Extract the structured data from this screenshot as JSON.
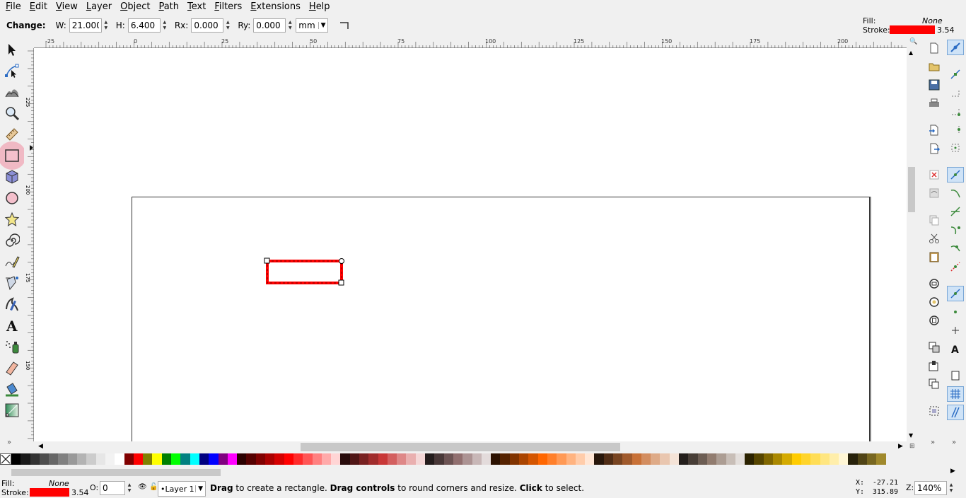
{
  "menu": [
    "File",
    "Edit",
    "View",
    "Layer",
    "Object",
    "Path",
    "Text",
    "Filters",
    "Extensions",
    "Help"
  ],
  "controls": {
    "change_label": "Change:",
    "w_label": "W:",
    "w_value": "21.000",
    "h_label": "H:",
    "h_value": "6.400",
    "rx_label": "Rx:",
    "rx_value": "0.000",
    "ry_label": "Ry:",
    "ry_value": "0.000",
    "unit": "mm"
  },
  "style_indicator_top": {
    "fill_label": "Fill:",
    "fill_value": "None",
    "stroke_label": "Stroke:",
    "stroke_width": "3.54",
    "stroke_color": "#ff0000"
  },
  "tools": [
    {
      "name": "selector-tool-icon",
      "icon": "arrow"
    },
    {
      "name": "node-tool-icon",
      "icon": "node"
    },
    {
      "name": "tweak-tool-icon",
      "icon": "tweak"
    },
    {
      "name": "zoom-tool-icon",
      "icon": "zoom"
    },
    {
      "name": "measure-tool-icon",
      "icon": "ruler"
    },
    {
      "name": "rect-tool-icon",
      "icon": "rect",
      "active": true
    },
    {
      "name": "3dbox-tool-icon",
      "icon": "box"
    },
    {
      "name": "ellipse-tool-icon",
      "icon": "ellipse"
    },
    {
      "name": "star-tool-icon",
      "icon": "star"
    },
    {
      "name": "spiral-tool-icon",
      "icon": "spiral"
    },
    {
      "name": "pencil-tool-icon",
      "icon": "pencil"
    },
    {
      "name": "pen-tool-icon",
      "icon": "pen"
    },
    {
      "name": "calligraphy-tool-icon",
      "icon": "calligraphy"
    },
    {
      "name": "text-tool-icon",
      "icon": "text"
    },
    {
      "name": "spray-tool-icon",
      "icon": "spray"
    },
    {
      "name": "eraser-tool-icon",
      "icon": "eraser"
    },
    {
      "name": "paint-bucket-tool-icon",
      "icon": "bucket"
    },
    {
      "name": "gradient-tool-icon",
      "icon": "gradient"
    }
  ],
  "ruler_top_labels": [
    "-25",
    "0",
    "25",
    "50",
    "75",
    "100",
    "125",
    "150",
    "175",
    "200"
  ],
  "ruler_left_labels": [
    "225",
    "200",
    "175",
    "150"
  ],
  "palette_colors": [
    "#000000",
    "#1a1a1a",
    "#333333",
    "#4d4d4d",
    "#666666",
    "#808080",
    "#999999",
    "#b3b3b3",
    "#cccccc",
    "#e6e6e6",
    "#f2f2f2",
    "#ffffff",
    "#800000",
    "#ff0000",
    "#808000",
    "#ffff00",
    "#008000",
    "#00ff00",
    "#008080",
    "#00ffff",
    "#000080",
    "#0000ff",
    "#800080",
    "#ff00ff",
    "#2b0000",
    "#550000",
    "#800000",
    "#aa0000",
    "#d40000",
    "#ff0000",
    "#ff2a2a",
    "#ff5555",
    "#ff8080",
    "#ffaaaa",
    "#ffd5d5",
    "#280b0b",
    "#501616",
    "#782121",
    "#a02c2c",
    "#c83737",
    "#d35f5f",
    "#de8787",
    "#e9afaf",
    "#f4d7d7",
    "#241c1c",
    "#483737",
    "#6c5353",
    "#916f6f",
    "#ac9393",
    "#c8b7b7",
    "#e3dbdb",
    "#2b1100",
    "#552200",
    "#803300",
    "#aa4400",
    "#d45500",
    "#ff6600",
    "#ff7f2a",
    "#ff9955",
    "#ffb380",
    "#ffccaa",
    "#ffe6d5",
    "#28170b",
    "#502d16",
    "#784421",
    "#a05a2c",
    "#c87137",
    "#d38d5f",
    "#deaa87",
    "#e9c6af",
    "#f4e3d7",
    "#241f1c",
    "#483e37",
    "#6c5d53",
    "#917c6f",
    "#ac9d93",
    "#c8beb7",
    "#e3dedb",
    "#2b2200",
    "#554400",
    "#806600",
    "#aa8800",
    "#d4aa00",
    "#ffcc00",
    "#ffd42a",
    "#ffdd55",
    "#ffe680",
    "#ffeeaa",
    "#fff6d5",
    "#28220b",
    "#504416",
    "#786721",
    "#a0892c"
  ],
  "status": {
    "fill_label": "Fill:",
    "fill_value": "None",
    "stroke_label": "Stroke:",
    "stroke_width": "3.54",
    "stroke_color": "#ff0000",
    "opacity_label": "O:",
    "opacity_value": "0",
    "layer": "•Layer 1",
    "msg_1": "Drag",
    "msg_2": " to create a rectangle. ",
    "msg_3": "Drag controls",
    "msg_4": " to round corners and resize. ",
    "msg_5": "Click",
    "msg_6": " to select.",
    "x_label": "X:",
    "x_value": "-27.21",
    "y_label": "Y:",
    "y_value": "315.89",
    "z_label": "Z:",
    "zoom": "140%"
  }
}
